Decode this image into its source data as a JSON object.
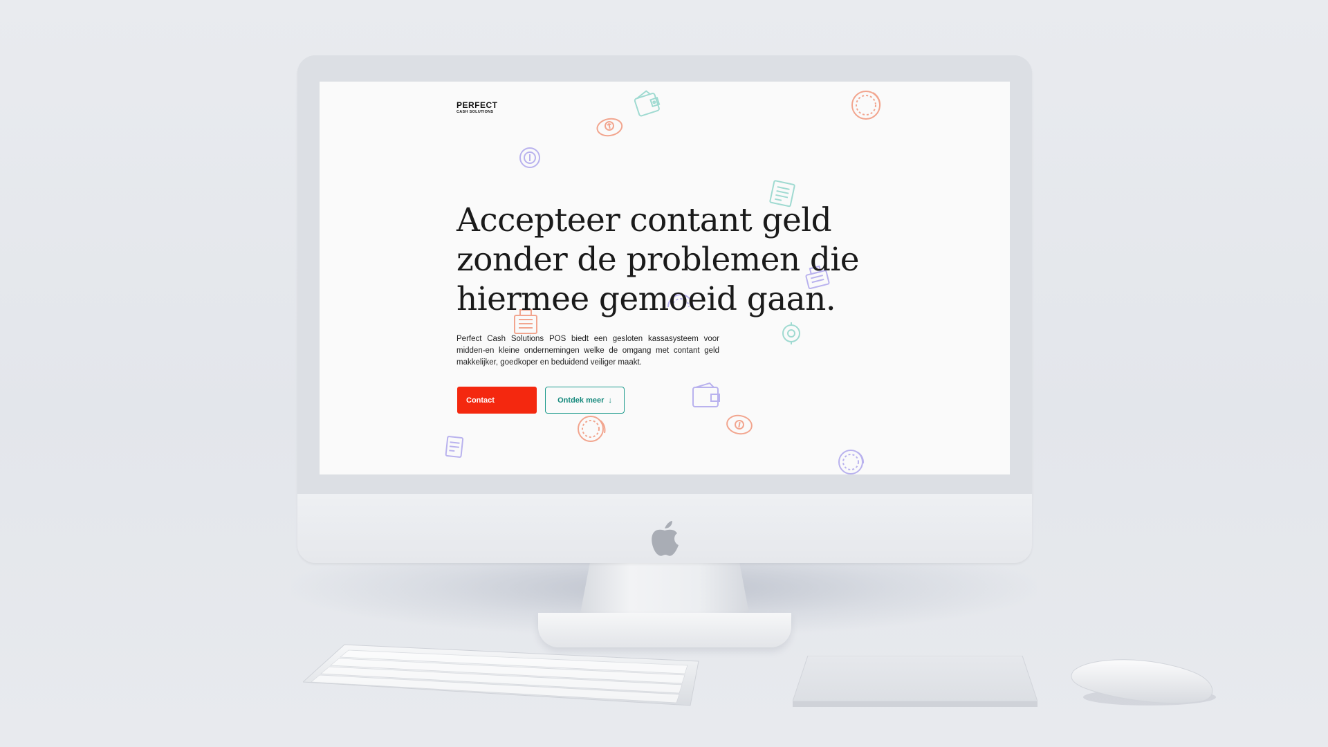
{
  "website": {
    "logo": {
      "top": "PERFECT",
      "bottom": "CASH SOLUTIONS"
    },
    "headline": "Accepteer contant geld zonder de problemen die hiermee gemoeid gaan.",
    "intro": "Perfect Cash Solutions POS biedt een gesloten kassasysteem voor midden-en kleine ondernemingen welke de omgang met contant geld makkelijker, goedkoper en beduidend veiliger maakt.",
    "buttons": {
      "contact_label": "Contact",
      "more_label": "Ontdek meer",
      "more_icon": "↓"
    }
  },
  "colors": {
    "accent_red": "#f4280f",
    "accent_teal": "#1c9a8c",
    "icon_orange": "#f2a58e",
    "icon_purple": "#b9b2ee",
    "icon_teal": "#9fdad1"
  },
  "icons": [
    "coin-icon",
    "wallet-icon",
    "cash-register-icon",
    "banknote-icon",
    "coin-stack-icon"
  ]
}
